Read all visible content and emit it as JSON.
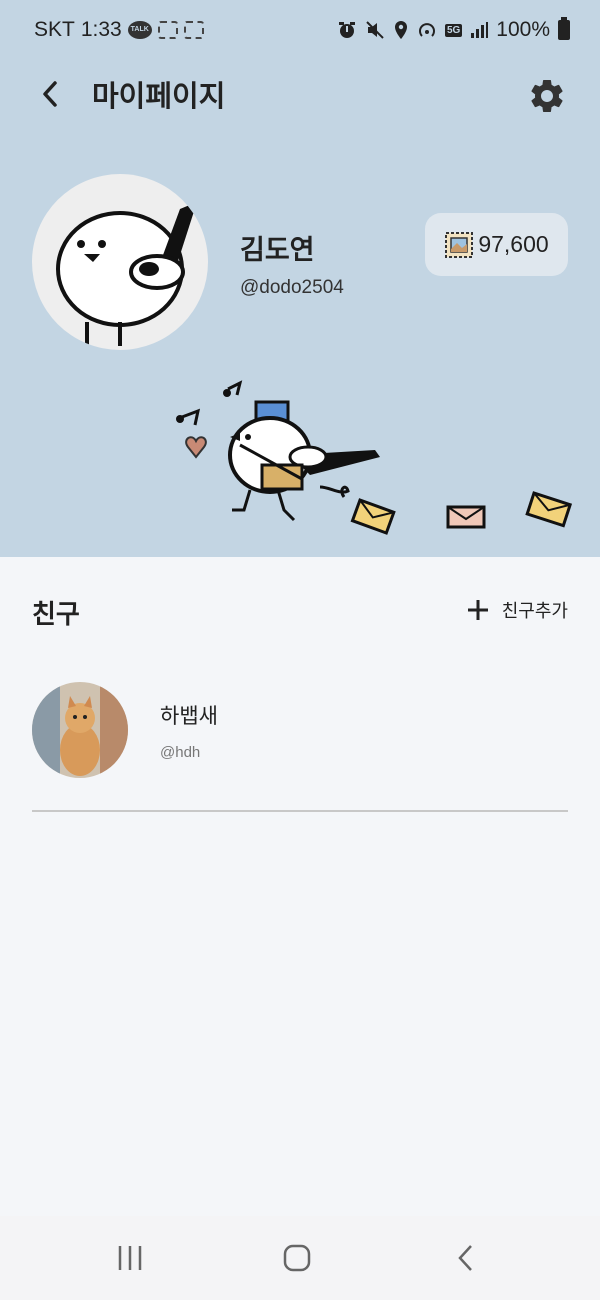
{
  "status_bar": {
    "carrier": "SKT",
    "time": "1:33",
    "kakao_badge": "TALK",
    "network_badge": "5G",
    "battery": "100%"
  },
  "header": {
    "title": "마이페이지",
    "back_icon": "chevron-left-icon",
    "settings_icon": "gear-icon"
  },
  "profile": {
    "name": "김도연",
    "handle": "@dodo2504",
    "points": "97,600",
    "points_icon": "stamp-icon"
  },
  "friends": {
    "title": "친구",
    "add_label": "친구추가",
    "items": [
      {
        "name": "하뱁새",
        "handle": "@hdh"
      }
    ]
  },
  "colors": {
    "header_bg": "#c3d5e3",
    "page_bg": "#f4f6f9",
    "badge_bg": "#dfe7ee"
  },
  "nav": {
    "recents_icon": "recent-apps-icon",
    "home_icon": "home-icon",
    "back_icon": "nav-back-icon"
  }
}
